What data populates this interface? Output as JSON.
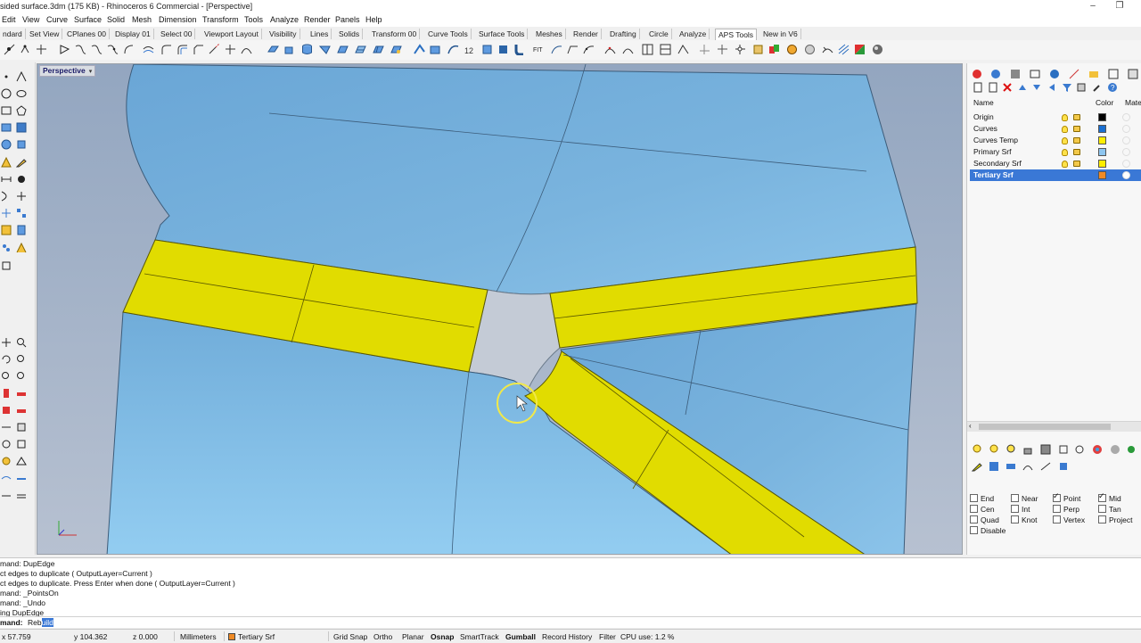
{
  "window": {
    "title": "sided surface.3dm (175 KB) - Rhinoceros 6 Commercial - [Perspective]",
    "controls": [
      "minimize-icon",
      "restore-icon"
    ]
  },
  "menu": [
    "Edit",
    "View",
    "Curve",
    "Surface",
    "Solid",
    "Mesh",
    "Dimension",
    "Transform",
    "Tools",
    "Analyze",
    "Render",
    "Panels",
    "Help"
  ],
  "toolbar_tabs": {
    "items": [
      "ndard",
      "Set View",
      "CPlanes 00",
      "Display 01",
      "Select 00",
      "Viewport Layout",
      "Visibility",
      "Lines",
      "Solids",
      "Transform 00",
      "Curve Tools",
      "Surface Tools",
      "Meshes",
      "Render",
      "Drafting",
      "Circle",
      "Analyze",
      "APS Tools",
      "New in V6"
    ],
    "active": "APS Tools"
  },
  "viewport": {
    "label": "Perspective",
    "colors": {
      "surface_blue": "#7cb4dc",
      "edge_highlight": "#e0dc00",
      "background": "#8fa4bf"
    }
  },
  "layers_panel": {
    "columns": {
      "name": "Name",
      "color": "Color",
      "material": "Mate"
    },
    "layers": [
      {
        "name": "Origin",
        "color": "#000000",
        "selected": false
      },
      {
        "name": "Curves",
        "color": "#1a6fd1",
        "selected": false
      },
      {
        "name": "Curves Temp",
        "color": "#ffee00",
        "selected": false
      },
      {
        "name": "Primary Srf",
        "color": "#8ec6f0",
        "selected": false
      },
      {
        "name": "Secondary Srf",
        "color": "#ffee00",
        "selected": false
      },
      {
        "name": "Tertiary Srf",
        "color": "#f08a24",
        "selected": true
      }
    ]
  },
  "osnap": [
    {
      "label": "End",
      "checked": false
    },
    {
      "label": "Near",
      "checked": false
    },
    {
      "label": "Point",
      "checked": true
    },
    {
      "label": "Mid",
      "checked": true
    },
    {
      "label": "Cen",
      "checked": false
    },
    {
      "label": "Int",
      "checked": false
    },
    {
      "label": "Perp",
      "checked": false
    },
    {
      "label": "Tan",
      "checked": false
    },
    {
      "label": "Quad",
      "checked": false
    },
    {
      "label": "Knot",
      "checked": false
    },
    {
      "label": "Vertex",
      "checked": false
    },
    {
      "label": "Project",
      "checked": false
    },
    {
      "label": "Disable",
      "checked": false
    }
  ],
  "command_history": [
    "mand: DupEdge",
    "ct edges to duplicate ( OutputLayer=Current )",
    "ct edges to duplicate. Press Enter when done ( OutputLayer=Current )",
    "mand: _PointsOn",
    "mand: _Undo",
    "ing DupEdge"
  ],
  "command_prompt": {
    "label": "mand:",
    "typed": "Reb",
    "highlighted": "uild"
  },
  "status": {
    "x": "x 57.759",
    "y": "y 104.362",
    "z": "z 0.000",
    "units": "Millimeters",
    "layer": "Tertiary Srf",
    "toggles": [
      {
        "label": "Grid Snap",
        "on": false
      },
      {
        "label": "Ortho",
        "on": false
      },
      {
        "label": "Planar",
        "on": false
      },
      {
        "label": "Osnap",
        "on": true
      },
      {
        "label": "SmartTrack",
        "on": false
      },
      {
        "label": "Gumball",
        "on": true
      },
      {
        "label": "Record History",
        "on": false
      },
      {
        "label": "Filter",
        "on": false
      }
    ],
    "cpu": "CPU use: 1.2 %"
  }
}
